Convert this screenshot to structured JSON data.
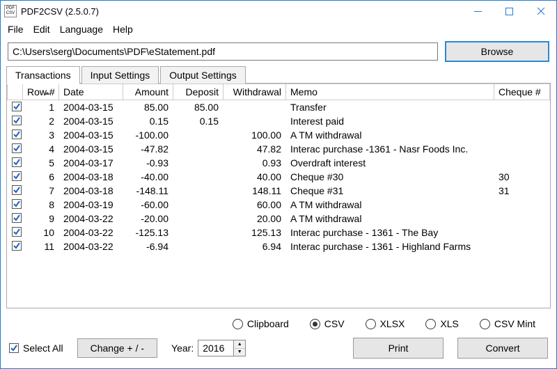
{
  "window": {
    "title": "PDF2CSV (2.5.0.7)"
  },
  "menu": {
    "file": "File",
    "edit": "Edit",
    "language": "Language",
    "help": "Help"
  },
  "file_path": "C:\\Users\\serg\\Documents\\PDF\\eStatement.pdf",
  "browse_label": "Browse",
  "tabs": {
    "transactions": "Transactions",
    "input": "Input Settings",
    "output": "Output Settings"
  },
  "columns": {
    "chk": "",
    "row": "Row #",
    "date": "Date",
    "amount": "Amount",
    "deposit": "Deposit",
    "withdrawal": "Withdrawal",
    "memo": "Memo",
    "cheque": "Cheque #"
  },
  "rows": [
    {
      "n": "1",
      "date": "2004-03-15",
      "amount": "85.00",
      "deposit": "85.00",
      "withdrawal": "",
      "memo": "Transfer",
      "cheque": ""
    },
    {
      "n": "2",
      "date": "2004-03-15",
      "amount": "0.15",
      "deposit": "0.15",
      "withdrawal": "",
      "memo": "Interest paid",
      "cheque": ""
    },
    {
      "n": "3",
      "date": "2004-03-15",
      "amount": "-100.00",
      "deposit": "",
      "withdrawal": "100.00",
      "memo": "A TM withdrawal",
      "cheque": ""
    },
    {
      "n": "4",
      "date": "2004-03-15",
      "amount": "-47.82",
      "deposit": "",
      "withdrawal": "47.82",
      "memo": "Interac purchase -1361 - Nasr Foods Inc.",
      "cheque": ""
    },
    {
      "n": "5",
      "date": "2004-03-17",
      "amount": "-0.93",
      "deposit": "",
      "withdrawal": "0.93",
      "memo": "Overdraft interest",
      "cheque": ""
    },
    {
      "n": "6",
      "date": "2004-03-18",
      "amount": "-40.00",
      "deposit": "",
      "withdrawal": "40.00",
      "memo": "Cheque #30",
      "cheque": "30"
    },
    {
      "n": "7",
      "date": "2004-03-18",
      "amount": "-148.11",
      "deposit": "",
      "withdrawal": "148.11",
      "memo": "Cheque #31",
      "cheque": "31"
    },
    {
      "n": "8",
      "date": "2004-03-19",
      "amount": "-60.00",
      "deposit": "",
      "withdrawal": "60.00",
      "memo": "A TM withdrawal",
      "cheque": ""
    },
    {
      "n": "9",
      "date": "2004-03-22",
      "amount": "-20.00",
      "deposit": "",
      "withdrawal": "20.00",
      "memo": "A TM withdrawal",
      "cheque": ""
    },
    {
      "n": "10",
      "date": "2004-03-22",
      "amount": "-125.13",
      "deposit": "",
      "withdrawal": "125.13",
      "memo": "Interac purchase - 1361 - The Bay",
      "cheque": ""
    },
    {
      "n": "11",
      "date": "2004-03-22",
      "amount": "-6.94",
      "deposit": "",
      "withdrawal": "6.94",
      "memo": "Interac purchase - 1361 - Highland Farms",
      "cheque": ""
    }
  ],
  "formats": {
    "clipboard": "Clipboard",
    "csv": "CSV",
    "xlsx": "XLSX",
    "xls": "XLS",
    "csvmint": "CSV Mint",
    "selected": "csv"
  },
  "bottom": {
    "select_all": "Select All",
    "change_sign": "Change + / -",
    "year_label": "Year:",
    "year_value": "2016",
    "print": "Print",
    "convert": "Convert"
  }
}
